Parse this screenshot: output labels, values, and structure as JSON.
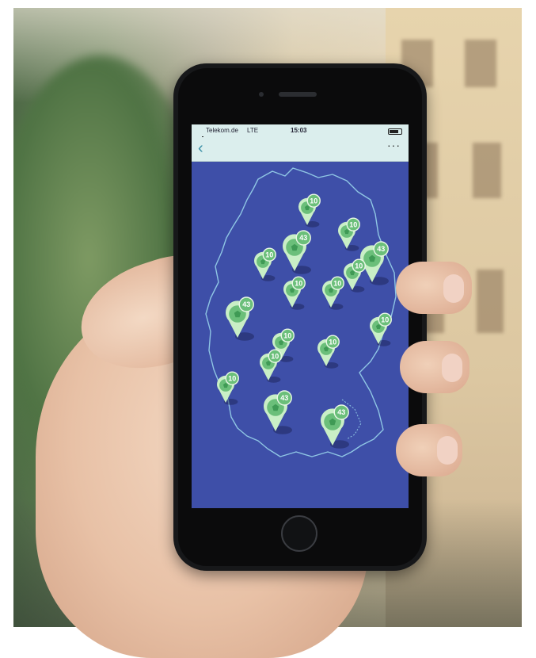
{
  "status_bar": {
    "carrier": "Telekom.de",
    "network": "LTE",
    "time": "15:03"
  },
  "nav": {
    "back_icon": "chevron-left-icon",
    "more_label": "···"
  },
  "map": {
    "region": "Germany",
    "markers": [
      {
        "count": "10",
        "size": "small"
      },
      {
        "count": "10",
        "size": "small"
      },
      {
        "count": "43",
        "size": "large"
      },
      {
        "count": "10",
        "size": "small"
      },
      {
        "count": "43",
        "size": "large"
      },
      {
        "count": "10",
        "size": "small"
      },
      {
        "count": "10",
        "size": "small"
      },
      {
        "count": "10",
        "size": "small"
      },
      {
        "count": "43",
        "size": "large"
      },
      {
        "count": "10",
        "size": "small"
      },
      {
        "count": "10",
        "size": "small"
      },
      {
        "count": "10",
        "size": "small"
      },
      {
        "count": "10",
        "size": "small"
      },
      {
        "count": "10",
        "size": "small"
      },
      {
        "count": "43",
        "size": "large"
      },
      {
        "count": "43",
        "size": "large"
      }
    ]
  },
  "colors": {
    "map_background": "#3e4fa8",
    "border_line": "#8fc6e4",
    "marker_green": "#6bbf7a",
    "marker_dark_green": "#3f9a55",
    "status_bar_bg": "#dbeeed"
  }
}
